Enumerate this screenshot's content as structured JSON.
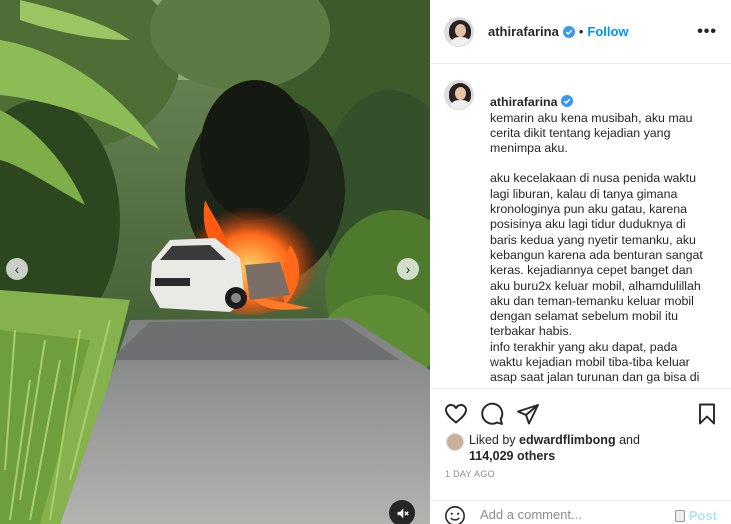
{
  "post": {
    "username": "athirafarina",
    "follow_label": "Follow",
    "separator": "•",
    "more_label": "•••"
  },
  "caption": {
    "username": "athirafarina",
    "intro": "kemarin aku kena musibah, aku mau cerita dikit tentang kejadian yang menimpa aku.",
    "body": "aku kecelakaan di nusa penida waktu lagi liburan, kalau di tanya gimana kronologinya pun aku gatau, karena posisinya aku lagi tidur duduknya di baris kedua yang nyetir temanku, aku kebangun karena ada benturan sangat keras. kejadiannya cepet banget dan aku buru2x keluar mobil, alhamdulillah aku dan teman-temanku keluar mobil dengan selamat sebelum mobil itu terbakar habis.\ninfo terakhir yang aku dapat, pada waktu kejadian mobil tiba-tiba keluar asap saat jalan turunan dan ga bisa di kendalikan. lalu mobil menabrak ke"
  },
  "likes": {
    "prefix": "Liked by",
    "liker": "edwardflimbong",
    "and": "and",
    "count_text": "114,029 others"
  },
  "timestamp": "1 DAY AGO",
  "comment": {
    "placeholder": "Add a comment...",
    "post_label": "Post"
  },
  "media": {
    "prev_glyph": "‹",
    "next_glyph": "›"
  },
  "icons": {
    "verified": "verified-badge-icon",
    "like": "heart-icon",
    "comment": "comment-bubble-icon",
    "share": "paper-plane-icon",
    "save": "bookmark-icon",
    "emoji": "smiley-icon",
    "mute": "speaker-muted-icon"
  },
  "colors": {
    "link_blue": "#0095f6",
    "post_disabled": "#b2dffc",
    "muted_text": "#8e8e8e"
  }
}
